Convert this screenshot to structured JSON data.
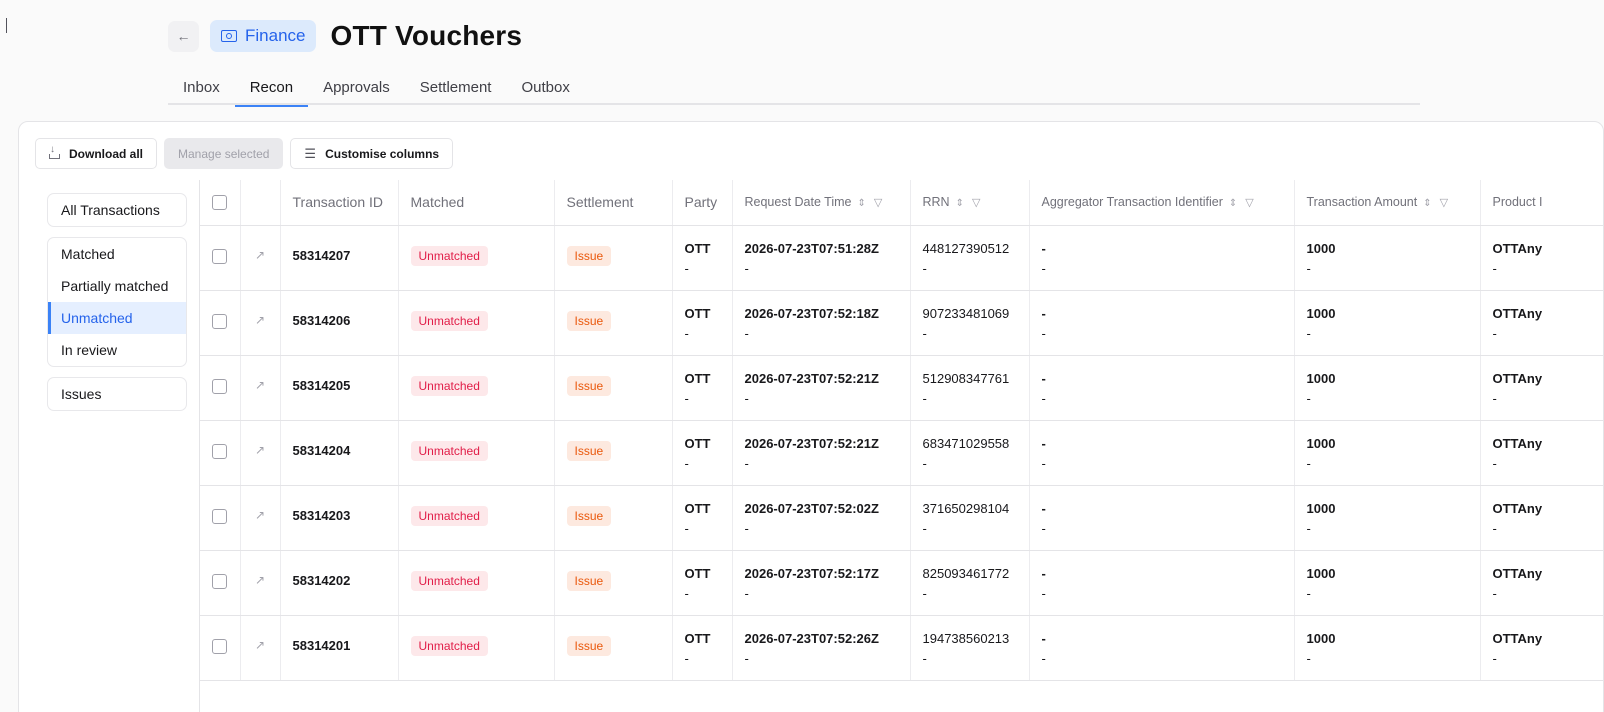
{
  "header": {
    "back_icon": "arrow-left-icon",
    "badge_label": "Finance",
    "title": "OTT Vouchers"
  },
  "tabs": [
    {
      "label": "Inbox",
      "active": false
    },
    {
      "label": "Recon",
      "active": true
    },
    {
      "label": "Approvals",
      "active": false
    },
    {
      "label": "Settlement",
      "active": false
    },
    {
      "label": "Outbox",
      "active": false
    }
  ],
  "toolbar": {
    "download_all": "Download all",
    "manage_selected": "Manage selected",
    "customise_columns": "Customise columns"
  },
  "filters": {
    "all": "All Transactions",
    "matched": "Matched",
    "partially_matched": "Partially matched",
    "unmatched": "Unmatched",
    "in_review": "In review",
    "issues": "Issues"
  },
  "columns": {
    "txid": "Transaction ID",
    "matched": "Matched",
    "settlement": "Settlement",
    "party": "Party",
    "request_dt": "Request Date Time",
    "rrn": "RRN",
    "aggregator": "Aggregator Transaction Identifier",
    "amount": "Transaction Amount",
    "product": "Product I"
  },
  "rows": [
    {
      "txid": "58314207",
      "matched": "Unmatched",
      "settlement": "Issue",
      "party": "OTT",
      "party2": "-",
      "dt": "2026-07-23T07:51:28Z",
      "dt2": "-",
      "rrn": "448127390512",
      "rrn2": "-",
      "agg": "-",
      "agg2": "-",
      "amount": "1000",
      "amount2": "-",
      "product": "OTTAny",
      "product2": "-"
    },
    {
      "txid": "58314206",
      "matched": "Unmatched",
      "settlement": "Issue",
      "party": "OTT",
      "party2": "-",
      "dt": "2026-07-23T07:52:18Z",
      "dt2": "-",
      "rrn": "907233481069",
      "rrn2": "-",
      "agg": "-",
      "agg2": "-",
      "amount": "1000",
      "amount2": "-",
      "product": "OTTAny",
      "product2": "-"
    },
    {
      "txid": "58314205",
      "matched": "Unmatched",
      "settlement": "Issue",
      "party": "OTT",
      "party2": "-",
      "dt": "2026-07-23T07:52:21Z",
      "dt2": "-",
      "rrn": "512908347761",
      "rrn2": "-",
      "agg": "-",
      "agg2": "-",
      "amount": "1000",
      "amount2": "-",
      "product": "OTTAny",
      "product2": "-"
    },
    {
      "txid": "58314204",
      "matched": "Unmatched",
      "settlement": "Issue",
      "party": "OTT",
      "party2": "-",
      "dt": "2026-07-23T07:52:21Z",
      "dt2": "-",
      "rrn": "683471029558",
      "rrn2": "-",
      "agg": "-",
      "agg2": "-",
      "amount": "1000",
      "amount2": "-",
      "product": "OTTAny",
      "product2": "-"
    },
    {
      "txid": "58314203",
      "matched": "Unmatched",
      "settlement": "Issue",
      "party": "OTT",
      "party2": "-",
      "dt": "2026-07-23T07:52:02Z",
      "dt2": "-",
      "rrn": "371650298104",
      "rrn2": "-",
      "agg": "-",
      "agg2": "-",
      "amount": "1000",
      "amount2": "-",
      "product": "OTTAny",
      "product2": "-"
    },
    {
      "txid": "58314202",
      "matched": "Unmatched",
      "settlement": "Issue",
      "party": "OTT",
      "party2": "-",
      "dt": "2026-07-23T07:52:17Z",
      "dt2": "-",
      "rrn": "825093461772",
      "rrn2": "-",
      "agg": "-",
      "agg2": "-",
      "amount": "1000",
      "amount2": "-",
      "product": "OTTAny",
      "product2": "-"
    },
    {
      "txid": "58314201",
      "matched": "Unmatched",
      "settlement": "Issue",
      "party": "OTT",
      "party2": "-",
      "dt": "2026-07-23T07:52:26Z",
      "dt2": "-",
      "rrn": "194738560213",
      "rrn2": "-",
      "agg": "-",
      "agg2": "-",
      "amount": "1000",
      "amount2": "-",
      "product": "OTTAny",
      "product2": "-"
    }
  ]
}
